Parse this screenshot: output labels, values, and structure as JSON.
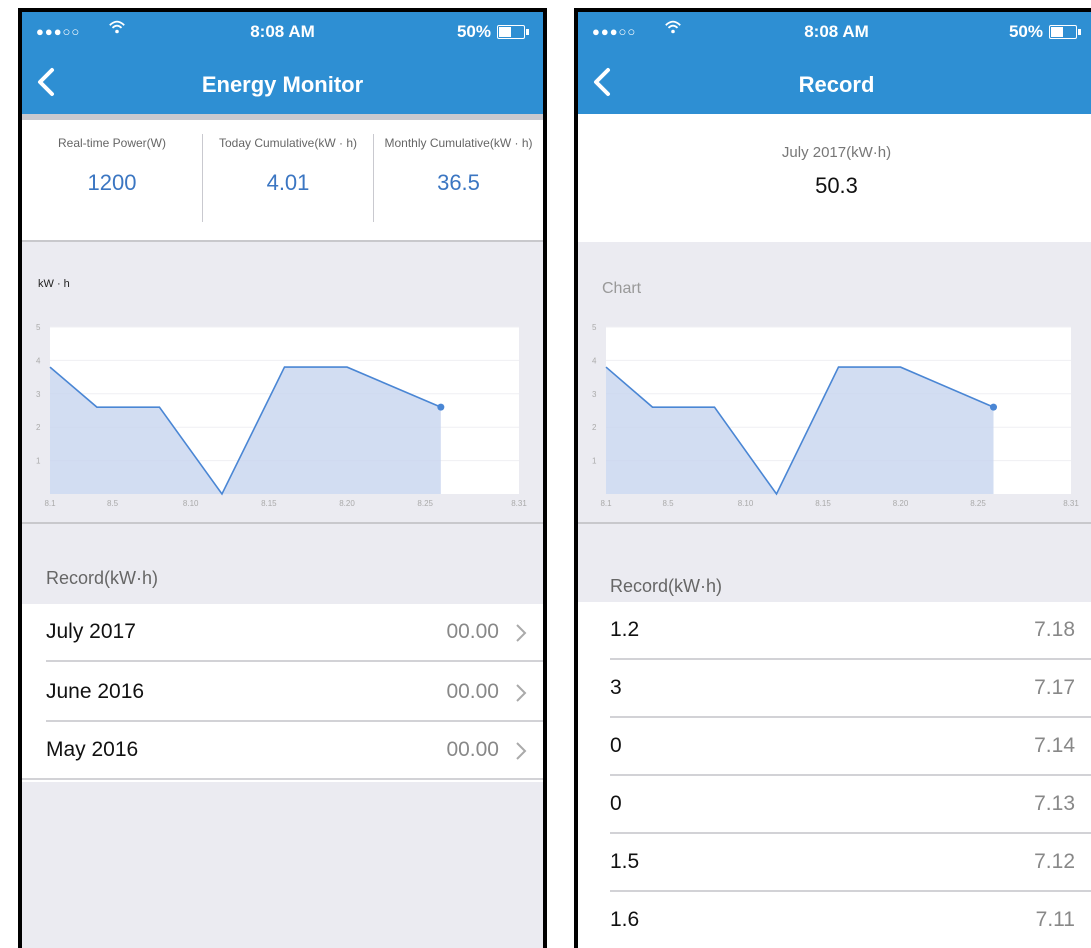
{
  "left": {
    "status": {
      "signal": "●●●○○",
      "time": "8:08 AM",
      "battery": "50%"
    },
    "title": "Energy Monitor",
    "summary": [
      {
        "label": "Real-time Power(W)",
        "value": "1200"
      },
      {
        "label": "Today Cumulative(kW · h)",
        "value": "4.01"
      },
      {
        "label": "Monthly Cumulative(kW · h)",
        "value": "36.5"
      }
    ],
    "chart_label": "kW · h",
    "record_header": "Record(kW·h)",
    "records": [
      {
        "month": "July 2017",
        "value": "00.00"
      },
      {
        "month": "June 2016",
        "value": "00.00"
      },
      {
        "month": "May 2016",
        "value": "00.00"
      }
    ]
  },
  "right": {
    "status": {
      "signal": "●●●○○",
      "time": "8:08 AM",
      "battery": "50%"
    },
    "title": "Record",
    "month_label": "July 2017(kW·h)",
    "month_value": "50.3",
    "chart_label": "Chart",
    "record_header": "Record(kW·h)",
    "records": [
      {
        "value": "1.2",
        "date": "7.18"
      },
      {
        "value": "3",
        "date": "7.17"
      },
      {
        "value": "0",
        "date": "7.14"
      },
      {
        "value": "0",
        "date": "7.13"
      },
      {
        "value": "1.5",
        "date": "7.12"
      },
      {
        "value": "1.6",
        "date": "7.11"
      }
    ]
  },
  "colors": {
    "accent": "#2e8fd3",
    "line": "#4a86d4",
    "fill": "#c7d5ef"
  },
  "chart_data": [
    {
      "type": "area",
      "xlabel": "",
      "ylabel": "kW · h",
      "x_ticks": [
        "8.1",
        "8.5",
        "8.10",
        "8.15",
        "8.20",
        "8.25",
        "8.31"
      ],
      "y_ticks": [
        "1",
        "2",
        "3",
        "4",
        "5"
      ],
      "ylim": [
        0,
        5
      ],
      "x": [
        1,
        4,
        8,
        12,
        16,
        20,
        26
      ],
      "values": [
        3.8,
        2.6,
        2.6,
        0,
        3.8,
        3.8,
        2.6
      ]
    },
    {
      "type": "area",
      "title": "Chart",
      "x_ticks": [
        "8.1",
        "8.5",
        "8.10",
        "8.15",
        "8.20",
        "8.25",
        "8.31"
      ],
      "y_ticks": [
        "1",
        "2",
        "3",
        "4",
        "5"
      ],
      "ylim": [
        0,
        5
      ],
      "x": [
        1,
        4,
        8,
        12,
        16,
        20,
        26
      ],
      "values": [
        3.8,
        2.6,
        2.6,
        0,
        3.8,
        3.8,
        2.6
      ]
    }
  ]
}
